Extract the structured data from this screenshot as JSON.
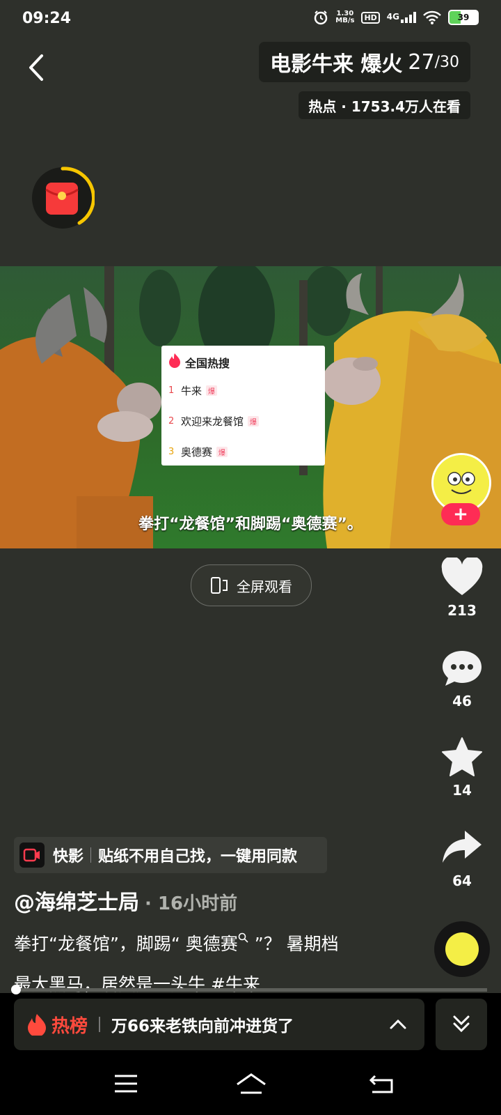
{
  "status_bar": {
    "time": "09:24",
    "net_speed_value": "1.30",
    "net_speed_unit": "MB/s",
    "hd": "HD",
    "network": "4G",
    "battery": "39",
    "battery_level": 0.39
  },
  "header": {
    "topic_title": "电影牛来 爆火",
    "topic_index": "27",
    "topic_total": "/30",
    "hot_label": "热点 · 1753.4万人在看"
  },
  "video": {
    "caption": "拳打“龙餐馆”和脚踢“奥德赛”。",
    "hot_card": {
      "title": "全国热搜",
      "items": [
        {
          "rank": "1",
          "text": "牛来",
          "tag": "爆"
        },
        {
          "rank": "2",
          "text": "欢迎来龙餐馆",
          "tag": "爆"
        },
        {
          "rank": "3",
          "text": "奥德赛",
          "tag": "爆"
        }
      ]
    }
  },
  "fullscreen_label": "全屏观看",
  "actions": {
    "like_count": "213",
    "comment_count": "46",
    "favorite_count": "14",
    "share_count": "64"
  },
  "follow_label": "+",
  "tool": {
    "name": "快影",
    "text": "贴纸不用自己找，一键用同款"
  },
  "post": {
    "author": "@海绵芝士局",
    "time": "· 16小时前",
    "desc_line1": "拳打“龙餐馆”，脚踢“ 奥德赛",
    "desc_line1_end": " ”？ 暑期档",
    "desc_line2": "最大黑马，居然是一头牛 #牛来"
  },
  "hotlist": {
    "label": "热榜",
    "text": "万66来老铁向前冲进货了"
  },
  "colors": {
    "accent": "#fe2c55",
    "hot": "#ff4a3d",
    "background": "#2e302b"
  }
}
